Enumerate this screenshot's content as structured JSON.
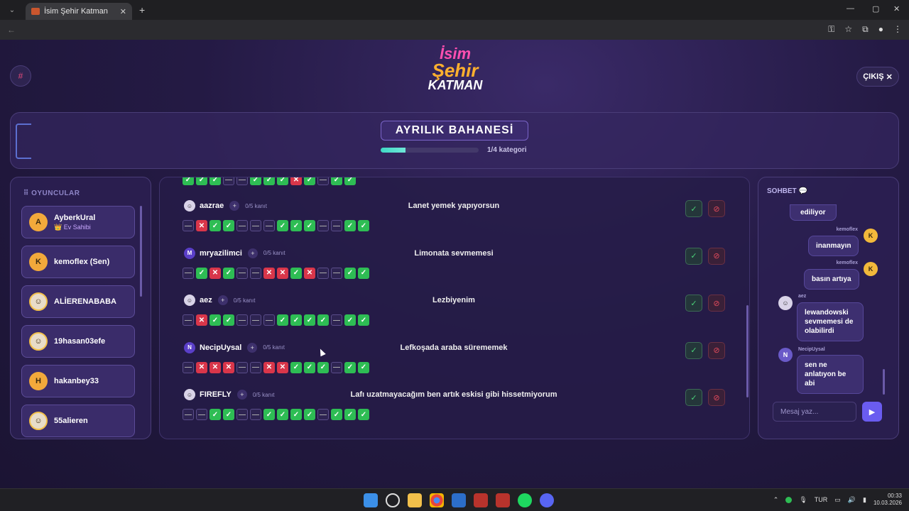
{
  "browser": {
    "tab_title": "İsim Şehir Katman",
    "tab_close": "✕",
    "new_tab": "+",
    "controls": [
      "—",
      "▢",
      "✕"
    ]
  },
  "game": {
    "logo": {
      "line1": "İsim",
      "line2": "Şehir",
      "line3": "KATMAN"
    },
    "exit_label": "ÇIKIŞ",
    "category_title": "AYRILIK BAHANESİ",
    "progress": {
      "fraction": 0.25,
      "label": "1/4 kategori"
    }
  },
  "players": {
    "title": "OYUNCULAR",
    "items": [
      {
        "initial": "A",
        "name": "AyberkUral",
        "sub": "👑 Ev Sahibi",
        "avatar": "letter"
      },
      {
        "initial": "K",
        "name": "kemoflex (Sen)",
        "sub": "",
        "avatar": "letter"
      },
      {
        "initial": "",
        "name": "ALİERENABABA",
        "sub": "",
        "avatar": "image"
      },
      {
        "initial": "",
        "name": "19hasan03efe",
        "sub": "",
        "avatar": "image"
      },
      {
        "initial": "H",
        "name": "hakanbey33",
        "sub": "",
        "avatar": "letter"
      },
      {
        "initial": "",
        "name": "55alieren",
        "sub": "",
        "avatar": "image"
      }
    ]
  },
  "answers": {
    "top_votes": [
      "ok",
      "ok",
      "ok",
      "na",
      "na",
      "ok",
      "ok",
      "ok",
      "no",
      "ok",
      "na",
      "ok",
      "ok"
    ],
    "rows": [
      {
        "initial": "",
        "avatar": "image",
        "user": "aazrae",
        "kanit": "0/5 kanıt",
        "answer": "Lanet yemek yapıyorsun",
        "votes": [
          "na",
          "no",
          "ok",
          "ok",
          "na",
          "na",
          "na",
          "ok",
          "ok",
          "ok",
          "na",
          "na",
          "ok",
          "ok"
        ]
      },
      {
        "initial": "M",
        "avatar": "letter",
        "user": "mryazilimci",
        "kanit": "0/5 kanıt",
        "answer": "Limonata sevmemesi",
        "votes": [
          "na",
          "ok",
          "no",
          "ok",
          "na",
          "na",
          "no",
          "no",
          "ok",
          "no",
          "na",
          "na",
          "ok",
          "ok"
        ]
      },
      {
        "initial": "",
        "avatar": "image",
        "user": "aez",
        "kanit": "0/5 kanıt",
        "answer": "Lezbiyenim",
        "votes": [
          "na",
          "no",
          "ok",
          "ok",
          "na",
          "na",
          "na",
          "ok",
          "ok",
          "ok",
          "ok",
          "na",
          "ok",
          "ok"
        ]
      },
      {
        "initial": "N",
        "avatar": "letter",
        "user": "NecipUysal",
        "kanit": "0/5 kanıt",
        "answer": "Lefkoşada araba sürememek",
        "votes": [
          "na",
          "no",
          "no",
          "no",
          "na",
          "na",
          "no",
          "no",
          "ok",
          "ok",
          "ok",
          "na",
          "ok",
          "ok"
        ]
      },
      {
        "initial": "",
        "avatar": "image",
        "user": "FIREFLY",
        "kanit": "0/5 kanıt",
        "answer": "Lafı uzatmayacağım ben artık eskisi gibi hissetmiyorum",
        "votes": [
          "na",
          "na",
          "ok",
          "ok",
          "na",
          "na",
          "ok",
          "ok",
          "ok",
          "ok",
          "na",
          "ok",
          "ok",
          "ok"
        ]
      }
    ]
  },
  "chat": {
    "title": "SOHBET 💬",
    "messages": [
      {
        "who": "",
        "text": "ediliyor"
      },
      {
        "who": "kemoflex",
        "initial": "K",
        "text": "inanmayın"
      },
      {
        "who": "kemoflex",
        "initial": "K",
        "text": "basın artıya"
      },
      {
        "who": "aez",
        "initial": "",
        "text": "lewandowski sevmemesi de olabilirdi"
      },
      {
        "who": "NecipUysal",
        "initial": "N",
        "text": "sen ne anlatıyon be abi"
      }
    ],
    "input_placeholder": "Mesaj yaz...",
    "send_icon": "▶"
  },
  "taskbar": {
    "lang": "TUR",
    "time": "00:33",
    "date": "10.03.2026"
  },
  "colors": {
    "accent": "#6a5cf0",
    "ok": "#2ebd54",
    "no": "#d9364a",
    "bg": "#241a44"
  }
}
